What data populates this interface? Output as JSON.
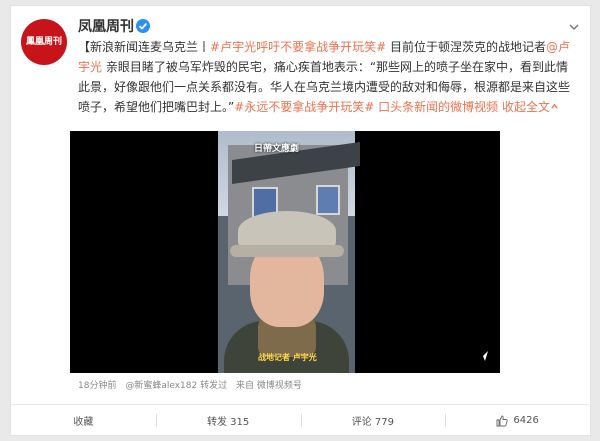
{
  "author": {
    "name": "凤凰周刊",
    "avatar_text": "鳳凰周刊"
  },
  "post": {
    "prefix": "【新浪新闻连麦乌克兰丨",
    "hashtag1": "#卢宇光呼吁不要拿战争开玩笑#",
    "text1": " 目前位于顿涅茨克的战地记者",
    "mention": "@卢宇光",
    "text2": " 亲眼目睹了被乌军炸毁的民宅，痛心疾首地表示：“那些网上的喷子坐在家中，看到此情此景，好像跟他们一点关系都没有。华人在乌克兰境内遭受的敌对和侮辱，根源都是来自这些喷子，希望他们把嘴巴封上。”",
    "hashtag2": "#永远不要拿战争开玩笑#",
    "video_link": "口头条新闻的微博视频",
    "collapse": "收起全文",
    "collapse_icon": "chevron-up"
  },
  "video": {
    "watermark": "日帶文應劇",
    "caption": "战地记者  卢宇光"
  },
  "meta": {
    "time": "18分钟前",
    "author": "@新蜜蜂alex182",
    "reposted": "转发过",
    "from_label": "来自",
    "source": "微博视频号"
  },
  "footer": {
    "favorite": "收藏",
    "repost": "转发 315",
    "comment": "评论 779",
    "like": "6426"
  },
  "colors": {
    "link": "#eb7350",
    "brand": "#c7131a",
    "verified": "#2b8ff5"
  }
}
